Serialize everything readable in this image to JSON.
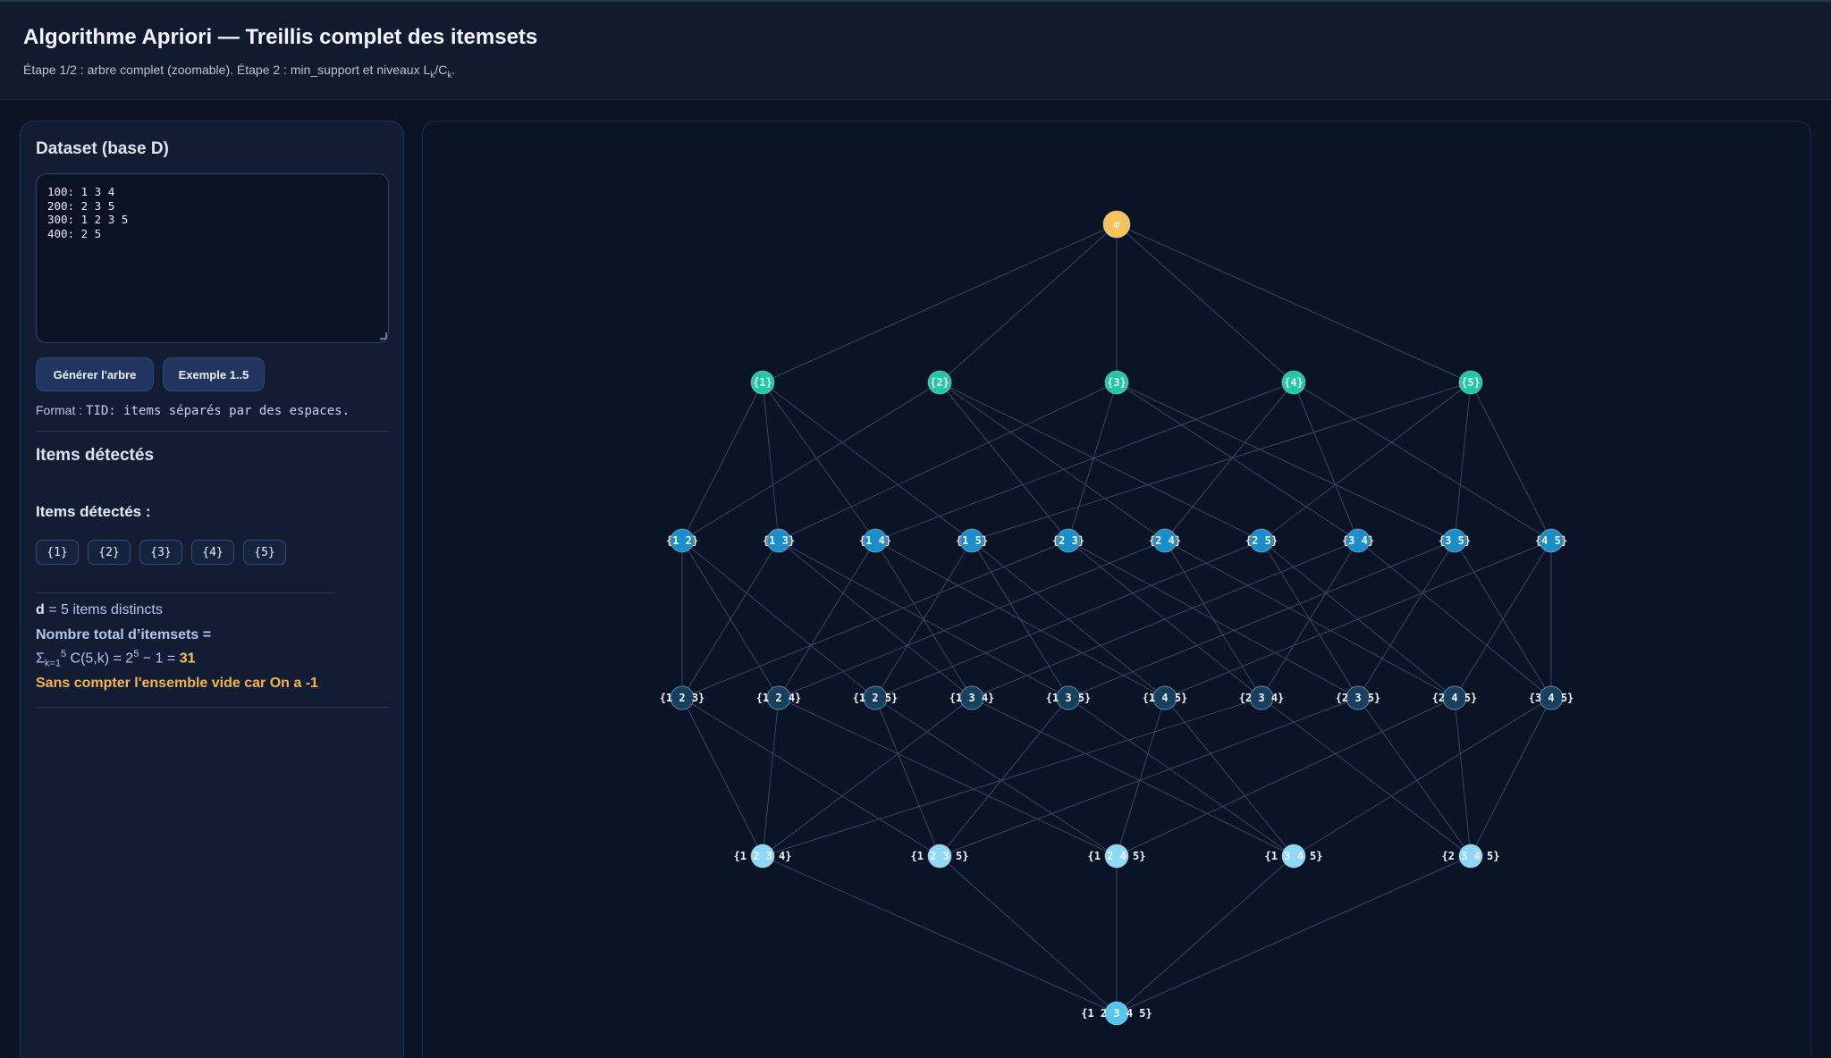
{
  "header": {
    "title": "Algorithme Apriori — Treillis complet des itemsets",
    "subtitle_pre": "Étape 1/2 : arbre complet (zoomable). Étape 2 : min_support et niveaux L",
    "subtitle_sub1": "k",
    "subtitle_mid": "/C",
    "subtitle_sub2": "k",
    "subtitle_post": "."
  },
  "sidebar": {
    "dataset_title": "Dataset (base D)",
    "dataset_value": "100: 1 3 4\n200: 2 3 5\n300: 1 2 3 5\n400: 2 5",
    "generate_button": "Générer l'arbre",
    "example_button": "Exemple 1..5",
    "format_label": "Format : ",
    "format_code": "TID: items séparés par des espaces.",
    "items_heading": "Items détectés",
    "items_subheading": "Items détectés :",
    "items": [
      "{1}",
      "{2}",
      "{3}",
      "{4}",
      "{5}"
    ],
    "d_label": "d",
    "d_text": " = 5 items distincts",
    "total_label": "Nombre total d’itemsets =",
    "formula_sigma": "Σ",
    "formula_sub": "k=1",
    "formula_sup": "5",
    "formula_mid": " C(5,k) = 2",
    "formula_sup2": "5",
    "formula_end": " − 1 = ",
    "formula_result": "31",
    "note": "Sans compter l'ensemble vide car On a -1"
  },
  "lattice": {
    "root_label": "∅",
    "colors": {
      "root": "#f6c35a",
      "level1": "#20c9a6",
      "level2": "#1a8ec8",
      "level3": "#17405e",
      "level4": "#8fd8f8",
      "level5": "#56c6f0",
      "edge": "#3a4562"
    },
    "levels": [
      [
        "∅"
      ],
      [
        "{1}",
        "{2}",
        "{3}",
        "{4}",
        "{5}"
      ],
      [
        "{1 2}",
        "{1 3}",
        "{1 4}",
        "{1 5}",
        "{2 3}",
        "{2 4}",
        "{2 5}",
        "{3 4}",
        "{3 5}",
        "{4 5}"
      ],
      [
        "{1 2 3}",
        "{1 2 4}",
        "{1 2 5}",
        "{1 3 4}",
        "{1 3 5}",
        "{1 4 5}",
        "{2 3 4}",
        "{2 3 5}",
        "{2 4 5}",
        "{3 4 5}"
      ],
      [
        "{1 2 3 4}",
        "{1 2 3 5}",
        "{1 2 4 5}",
        "{1 3 4 5}",
        "{2 3 4 5}"
      ],
      [
        "{1 2 3 4 5}"
      ]
    ]
  }
}
